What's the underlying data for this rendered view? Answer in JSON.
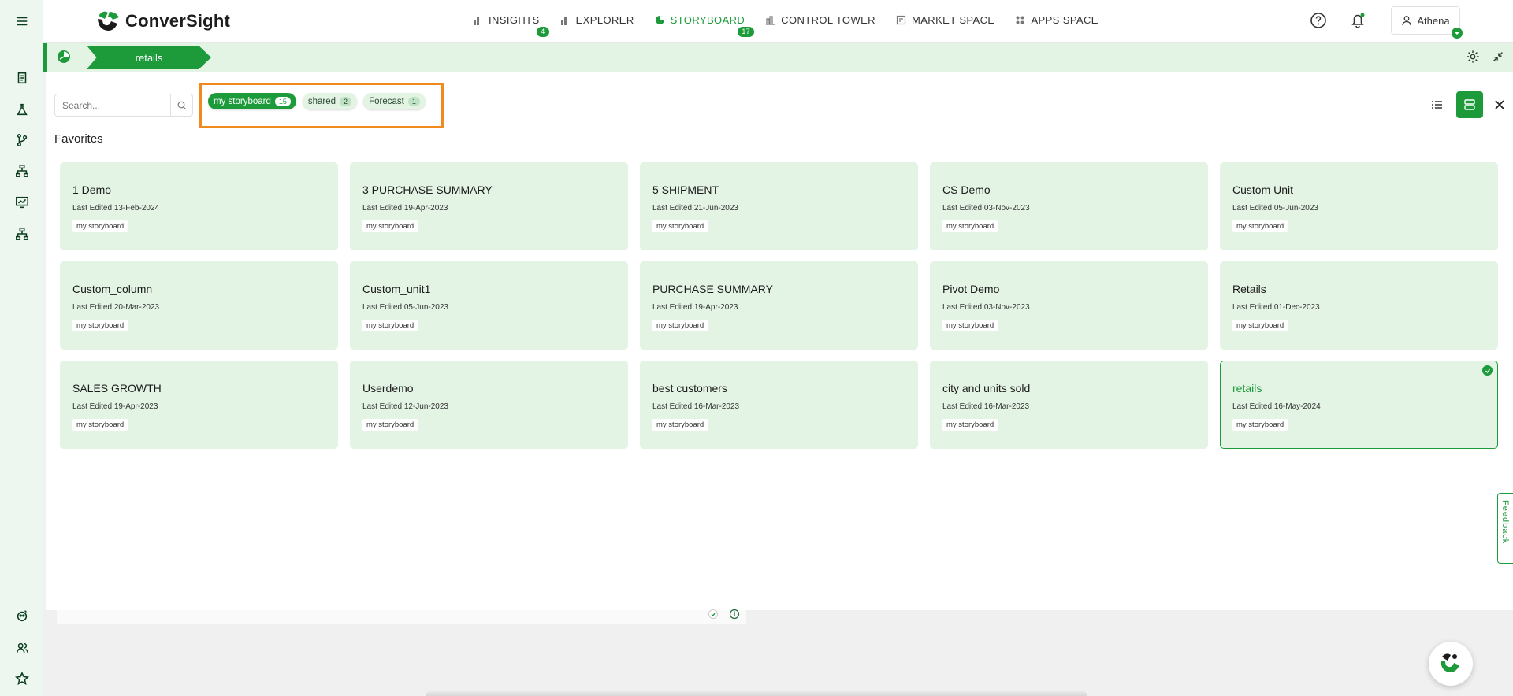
{
  "app": {
    "brand": "ConverSight",
    "accent_color": "#1d9a3a",
    "highlight_color": "#f08a1f"
  },
  "nav": [
    {
      "label": "INSIGHTS",
      "badge": "4",
      "icon": "bar-chart-icon"
    },
    {
      "label": "EXPLORER",
      "badge": "",
      "icon": "explorer-icon"
    },
    {
      "label": "STORYBOARD",
      "badge": "17",
      "icon": "storyboard-icon",
      "active": true
    },
    {
      "label": "CONTROL TOWER",
      "badge": "",
      "icon": "control-tower-icon"
    },
    {
      "label": "MARKET SPACE",
      "badge": "",
      "icon": "market-space-icon"
    },
    {
      "label": "APPS SPACE",
      "badge": "",
      "icon": "apps-space-icon"
    }
  ],
  "user": {
    "name": "Athena"
  },
  "breadcrumb": {
    "current": "retails"
  },
  "search": {
    "placeholder": "Search..."
  },
  "filters": [
    {
      "label": "my storyboard",
      "count": "15",
      "active": true
    },
    {
      "label": "shared",
      "count": "2",
      "active": false
    },
    {
      "label": "Forecast",
      "count": "1",
      "active": false
    }
  ],
  "section": {
    "title": "Favorites"
  },
  "cards": [
    {
      "title": "1 Demo",
      "date": "Last Edited 13-Feb-2024",
      "tag": "my storyboard"
    },
    {
      "title": "3 PURCHASE SUMMARY",
      "date": "Last Edited 19-Apr-2023",
      "tag": "my storyboard"
    },
    {
      "title": "5 SHIPMENT",
      "date": "Last Edited 21-Jun-2023",
      "tag": "my storyboard"
    },
    {
      "title": "CS Demo",
      "date": "Last Edited 03-Nov-2023",
      "tag": "my storyboard"
    },
    {
      "title": "Custom Unit",
      "date": "Last Edited 05-Jun-2023",
      "tag": "my storyboard"
    },
    {
      "title": "Custom_column",
      "date": "Last Edited 20-Mar-2023",
      "tag": "my storyboard"
    },
    {
      "title": "Custom_unit1",
      "date": "Last Edited 05-Jun-2023",
      "tag": "my storyboard"
    },
    {
      "title": "PURCHASE SUMMARY",
      "date": "Last Edited 19-Apr-2023",
      "tag": "my storyboard"
    },
    {
      "title": "Pivot Demo",
      "date": "Last Edited 03-Nov-2023",
      "tag": "my storyboard"
    },
    {
      "title": "Retails",
      "date": "Last Edited 01-Dec-2023",
      "tag": "my storyboard"
    },
    {
      "title": "SALES GROWTH",
      "date": "Last Edited 19-Apr-2023",
      "tag": "my storyboard"
    },
    {
      "title": "Userdemo",
      "date": "Last Edited 12-Jun-2023",
      "tag": "my storyboard"
    },
    {
      "title": "best customers",
      "date": "Last Edited 16-Mar-2023",
      "tag": "my storyboard"
    },
    {
      "title": "city and units sold",
      "date": "Last Edited 16-Mar-2023",
      "tag": "my storyboard"
    },
    {
      "title": "retails",
      "date": "Last Edited 16-May-2024",
      "tag": "my storyboard",
      "selected": true
    }
  ],
  "feedback": {
    "label": "Feedback"
  }
}
